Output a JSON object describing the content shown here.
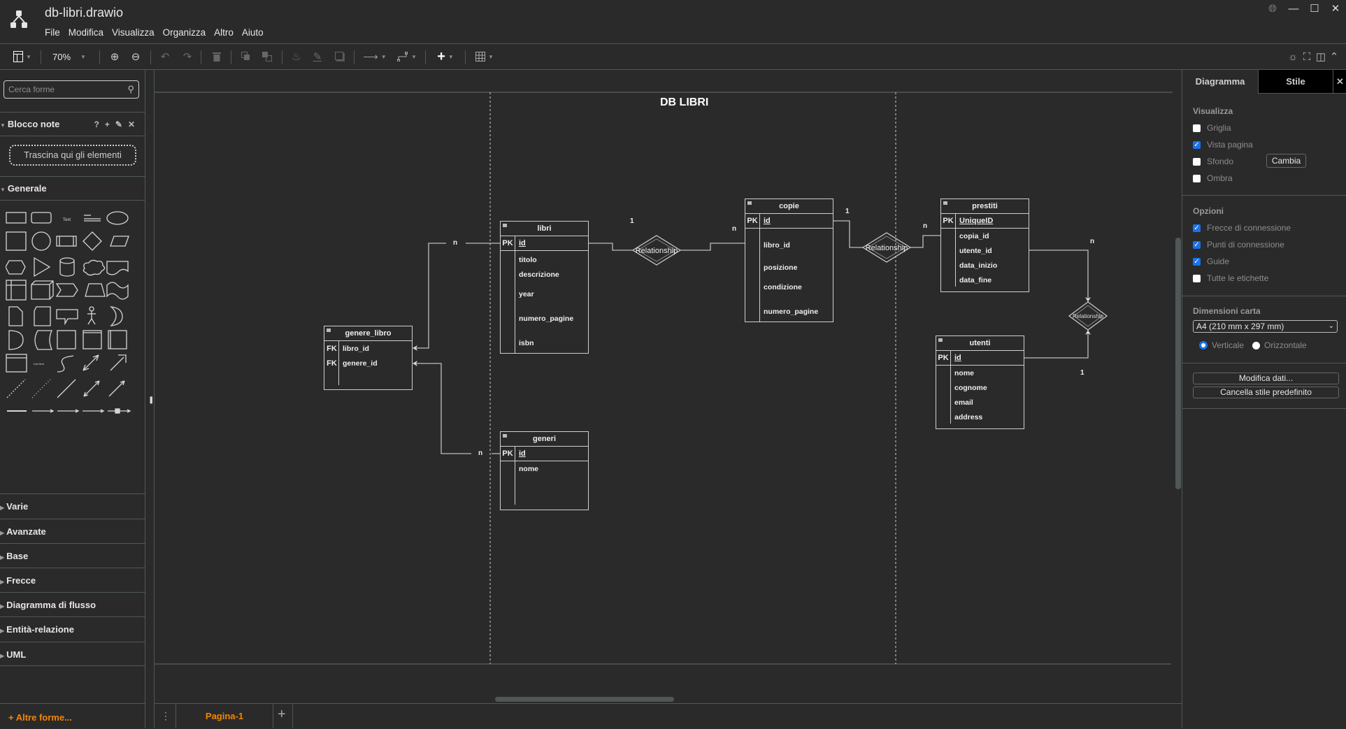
{
  "app": {
    "title": "db-libri.drawio",
    "menu": [
      "File",
      "Modifica",
      "Visualizza",
      "Organizza",
      "Altro",
      "Aiuto"
    ],
    "window_controls": [
      "globe-icon",
      "minimize",
      "maximize",
      "close"
    ]
  },
  "toolbar": {
    "zoom_level": "70%",
    "buttons": [
      "format-panel",
      "zoom-in",
      "zoom-out",
      "undo",
      "redo",
      "delete",
      "to-front",
      "to-back",
      "fill-color",
      "line-color",
      "shadow",
      "connection",
      "waypoints",
      "insert",
      "table"
    ],
    "right_buttons": [
      "appearance",
      "fullscreen",
      "format-toggle",
      "collapse"
    ]
  },
  "sidebar": {
    "search_placeholder": "Cerca forme",
    "scratchpad": {
      "title": "Blocco note",
      "tools": [
        "?",
        "+",
        "✎",
        "✕"
      ],
      "drop_hint": "Trascina qui gli elementi"
    },
    "general_title": "Generale",
    "sections": [
      "Varie",
      "Avanzate",
      "Base",
      "Frecce",
      "Diagramma di flusso",
      "Entità-relazione",
      "UML"
    ],
    "more_shapes": "+ Altre forme..."
  },
  "canvas": {
    "title": "DB LIBRI",
    "entities": [
      {
        "name": "libri",
        "pk": "id",
        "attributes": [
          "titolo",
          "descrizione",
          "year",
          "numero_pagine",
          "isbn"
        ]
      },
      {
        "name": "copie",
        "pk": "id",
        "attributes": [
          "libro_id",
          "posizione",
          "condizione",
          "numero_pagine"
        ]
      },
      {
        "name": "prestiti",
        "pk": "UniqueID",
        "attributes": [
          "copia_id",
          "utente_id",
          "data_inizio",
          "data_fine"
        ]
      },
      {
        "name": "utenti",
        "pk": "id",
        "attributes": [
          "nome",
          "cognome",
          "email",
          "address"
        ]
      },
      {
        "name": "genere_libro",
        "fk": [
          "libro_id",
          "genere_id"
        ]
      },
      {
        "name": "generi",
        "pk": "id",
        "attributes": [
          "nome"
        ]
      }
    ],
    "key_labels": {
      "pk": "PK",
      "fk": "FK"
    },
    "relationship_label": "Relationship",
    "cardinalities": {
      "libri_copie": [
        "1",
        "n"
      ],
      "copie_prestiti": [
        "1",
        "n"
      ],
      "prestiti_utenti": [
        "n",
        "1"
      ],
      "libri_genere_libro": "n",
      "generi_genere_libro": "n"
    }
  },
  "pages": {
    "tabs": [
      "Pagina-1"
    ]
  },
  "format_panel": {
    "tabs": [
      "Diagramma",
      "Stile"
    ],
    "view_title": "Visualizza",
    "view_options": [
      {
        "label": "Griglia",
        "checked": false
      },
      {
        "label": "Vista pagina",
        "checked": true
      },
      {
        "label": "Sfondo",
        "checked": false
      },
      {
        "label": "Ombra",
        "checked": false
      }
    ],
    "change_button": "Cambia",
    "options_title": "Opzioni",
    "options": [
      {
        "label": "Frecce di connessione",
        "checked": true
      },
      {
        "label": "Punti di connessione",
        "checked": true
      },
      {
        "label": "Guide",
        "checked": true
      },
      {
        "label": "Tutte le etichette",
        "checked": false
      }
    ],
    "paper_title": "Dimensioni carta",
    "paper_size": "A4 (210 mm x 297 mm)",
    "orientation": [
      {
        "label": "Verticale",
        "selected": true
      },
      {
        "label": "Orizzontale",
        "selected": false
      }
    ],
    "edit_data_button": "Modifica dati...",
    "clear_style_button": "Cancella stile predefinito"
  }
}
